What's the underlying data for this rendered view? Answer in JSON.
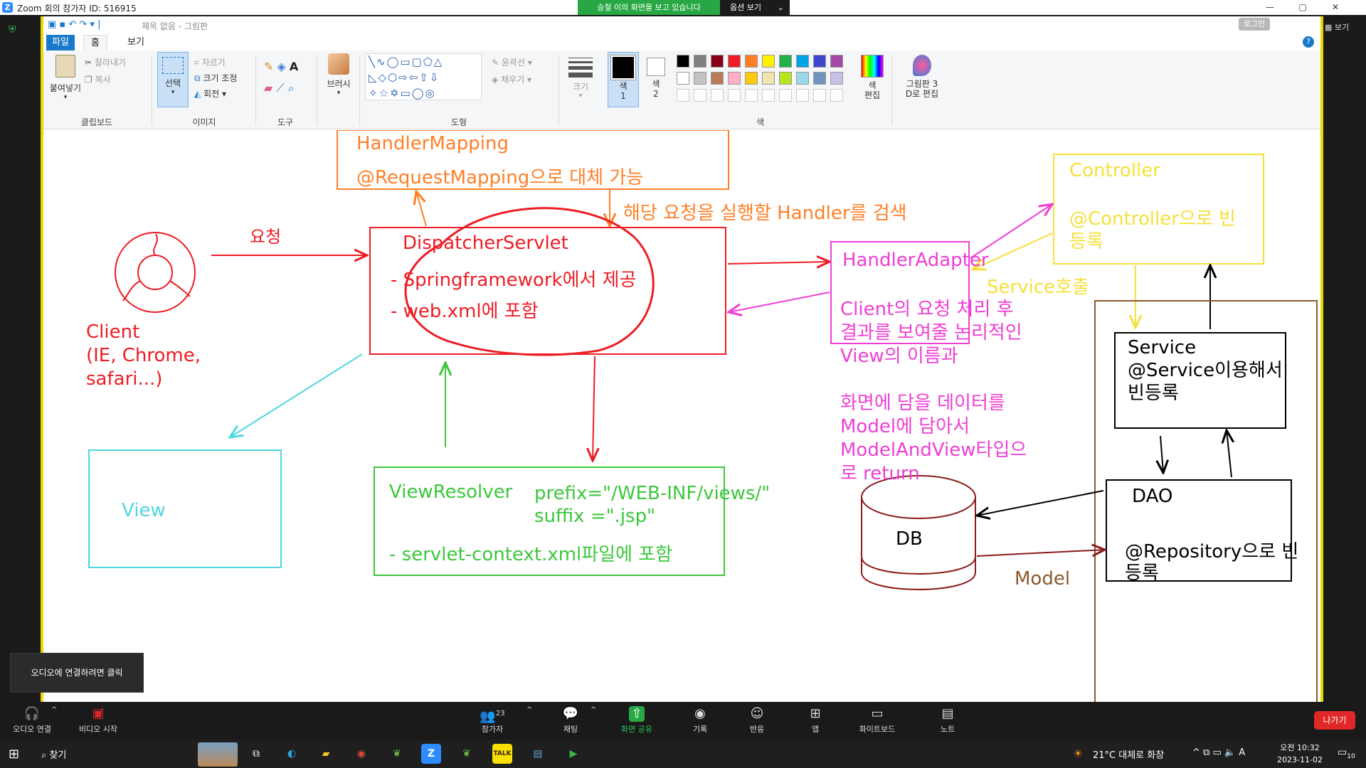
{
  "zoom_titlebar": {
    "title": "Zoom 회의 참가자 ID: 516915",
    "share_banner": "승철 이의 화면을 보고 있습니다",
    "options_button": "옵션 보기",
    "view_button": "보기"
  },
  "paint": {
    "window_title": "제목 없음 - 그림판",
    "signin": "로그인",
    "tabs": [
      "파일",
      "홈",
      "보기"
    ],
    "clipboard": {
      "paste": "붙여넣기",
      "cut": "잘라내기",
      "copy": "복사",
      "label": "클립보드"
    },
    "image": {
      "select": "선택",
      "crop": "자르기",
      "resize": "크기 조정",
      "rotate": "회전",
      "label": "이미지"
    },
    "tools_label": "도구",
    "brush": "브러시",
    "shapes": {
      "outline": "윤곽선",
      "fill": "채우기",
      "label": "도형"
    },
    "size": "크기",
    "color1": "색\n1",
    "color2": "색\n2",
    "colors_label": "색",
    "edit_colors": "색\n편집",
    "edit_3d": "그림판 3\nD로 편집",
    "palette_row1": [
      "#000000",
      "#7f7f7f",
      "#880015",
      "#ed1c24",
      "#ff7f27",
      "#fff200",
      "#22b14c",
      "#00a2e8",
      "#3f48cc",
      "#a349a4"
    ],
    "palette_row2": [
      "#ffffff",
      "#c3c3c3",
      "#b97a57",
      "#ffaec9",
      "#ffc90e",
      "#efe4b0",
      "#b5e61d",
      "#99d9ea",
      "#7092be",
      "#c8bfe7"
    ]
  },
  "diagram": {
    "handler_mapping": {
      "title": "HandlerMapping",
      "note": "@RequestMapping으로 대체 가능"
    },
    "search_note": "해당 요청을 실행할 Handler를 검색",
    "request_label": "요청",
    "dispatcher": {
      "title": "DispatcherServlet",
      "line1": "- Springframework에서 제공",
      "line2": "- web.xml에 포함"
    },
    "client": {
      "line1": "Client",
      "line2": "(IE, Chrome,",
      "line3": "safari...)"
    },
    "handler_adapter": {
      "title": "HandlerAdapter"
    },
    "adapter_note": [
      "Client의 요청 처리 후",
      "결과를 보여줄 논리적인",
      "View의 이름과",
      "",
      "화면에 담을 데이터를",
      "Model에 담아서",
      "ModelAndView타입으",
      "로 return"
    ],
    "controller": {
      "title": "Controller",
      "line1": "@Controller으로 빈",
      "line2": "등록"
    },
    "service_call": "Service호출",
    "service": {
      "line1": "Service",
      "line2": "@Service이용해서",
      "line3": "빈등록"
    },
    "dao": {
      "title": "DAO",
      "line1": "@Repository으로 빈",
      "line2": "등록"
    },
    "db": "DB",
    "model_label": "Model",
    "view": "View",
    "view_resolver": {
      "title": "ViewResolver",
      "prefix": "prefix=\"/WEB-INF/views/\"",
      "suffix": "suffix =\".jsp\"",
      "note": "- servlet-context.xml파일에 포함"
    },
    "colors": {
      "red": "#ee1c24",
      "orange": "#ff7f27",
      "yellow": "#f5e03a",
      "magenta": "#ee3ed4",
      "cyan": "#4fd6e0",
      "green": "#3cc73c",
      "brown": "#8b5a2b",
      "black": "#000000"
    }
  },
  "zoom_bar": {
    "audio_tip": "오디오에 연결하려면 클릭",
    "items": [
      {
        "label": "오디오 연결",
        "icon": "headphone-icon"
      },
      {
        "label": "비디오 시작",
        "icon": "video-off-icon"
      },
      {
        "label": "참가자",
        "icon": "participants-icon",
        "count": "23"
      },
      {
        "label": "채팅",
        "icon": "chat-icon"
      },
      {
        "label": "화면 공유",
        "icon": "share-screen-icon"
      },
      {
        "label": "기록",
        "icon": "record-icon"
      },
      {
        "label": "반응",
        "icon": "reaction-icon"
      },
      {
        "label": "앱",
        "icon": "apps-icon"
      },
      {
        "label": "화이트보드",
        "icon": "whiteboard-icon"
      },
      {
        "label": "노트",
        "icon": "notes-icon"
      }
    ],
    "leave": "나가기"
  },
  "taskbar": {
    "search": "찾기",
    "weather": "21°C 대체로 화창",
    "time": "오전 10:32",
    "date": "2023-11-02",
    "ime": "A",
    "notifications": "10"
  }
}
